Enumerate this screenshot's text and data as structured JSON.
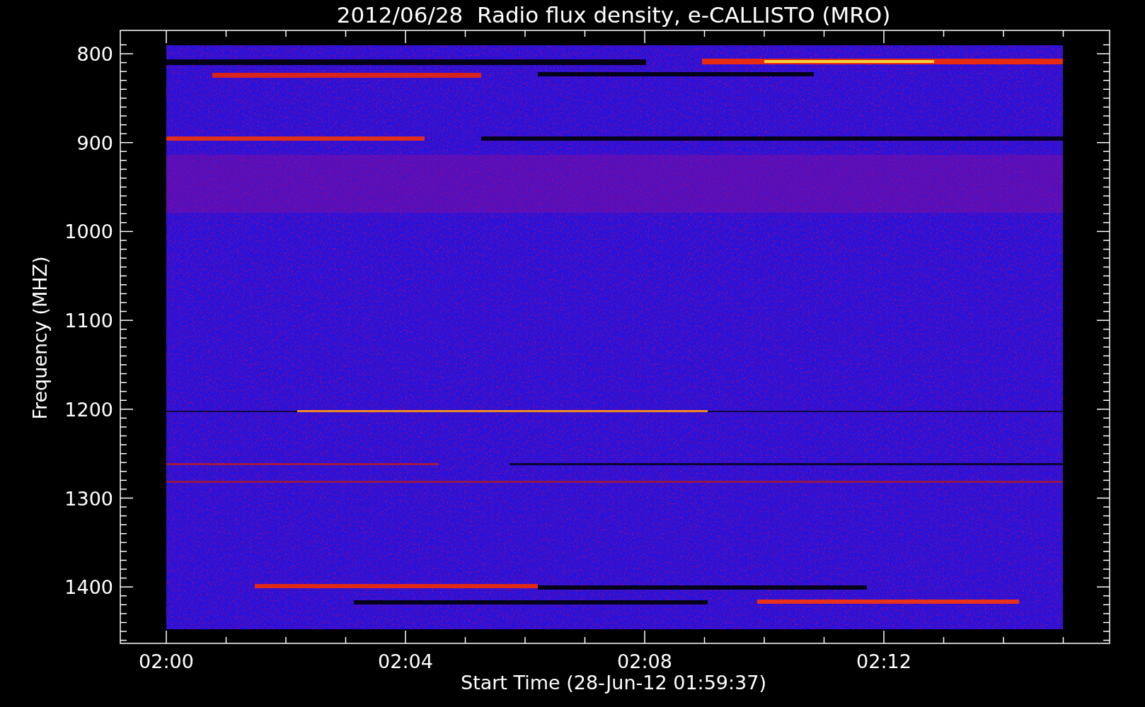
{
  "title": "2012/06/28  Radio flux density, e-CALLISTO (MRO)",
  "y_axis": {
    "label": "Frequency (MHZ)",
    "ticks": [
      "800",
      "900",
      "1000",
      "1100",
      "1200",
      "1300",
      "1400"
    ]
  },
  "x_axis": {
    "label": "Start Time (28-Jun-12 01:59:37)",
    "ticks": [
      "02:00",
      "02:04",
      "02:08",
      "02:12"
    ]
  }
}
